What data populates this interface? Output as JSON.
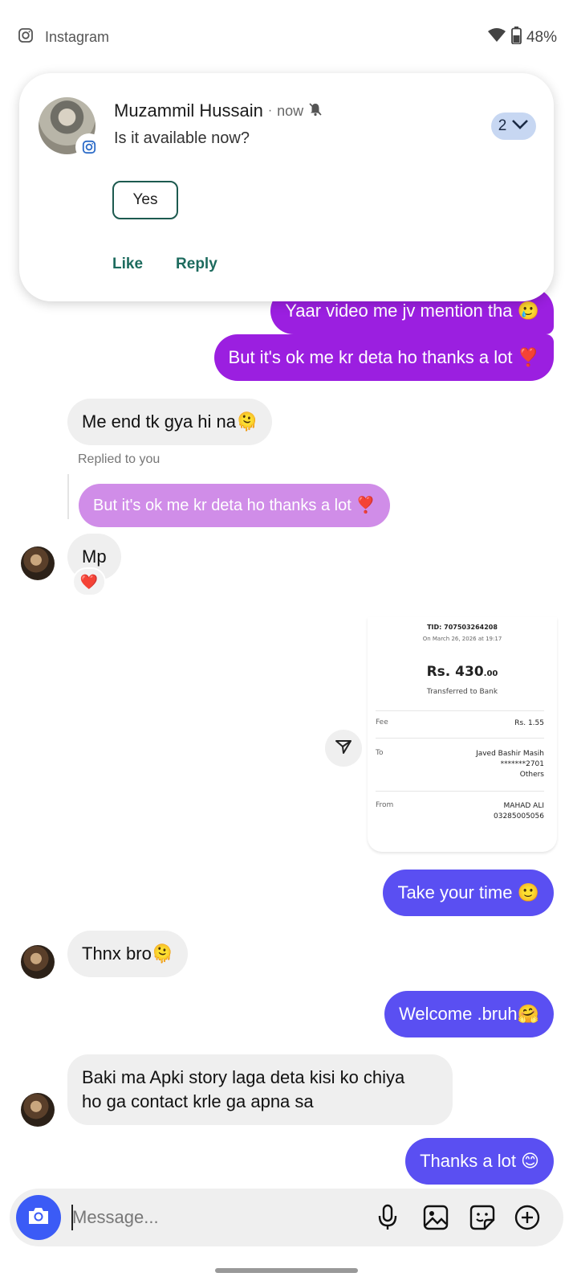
{
  "status_bar": {
    "app_name": "Instagram",
    "battery": "48%"
  },
  "notification": {
    "sender": "Muzammil Hussain",
    "separator": "·",
    "time": "now",
    "message": "Is it available now?",
    "count": "2",
    "quick_reply": "Yes",
    "actions": [
      "Like",
      "Reply"
    ]
  },
  "messages": [
    {
      "side": "sent",
      "text": "Yaar video me jv mention tha 🥲"
    },
    {
      "side": "sent",
      "text": "But it's ok me kr deta ho thanks a lot ❣️"
    },
    {
      "side": "received",
      "text": "Me end tk gya hi na🫠"
    },
    {
      "side": "received",
      "replied_label": "Replied to you",
      "quoted": "But it's ok me kr deta ho thanks a lot ❣️",
      "text": "Mp",
      "reaction": "❤️"
    },
    {
      "side": "sent",
      "type": "image",
      "receipt": {
        "tid": "TID: 707503264208",
        "date": "On March 26, 2026 at 19:17",
        "amount": "Rs. 430",
        "amount_decimals": ".00",
        "status": "Transferred to Bank",
        "fee_label": "Fee",
        "fee_value": "Rs. 1.55",
        "to_label": "To",
        "to_lines": [
          "Javed Bashir Masih",
          "*******2701",
          "Others"
        ],
        "from_label": "From",
        "from_lines": [
          "MAHAD ALI",
          "03285005056"
        ]
      }
    },
    {
      "side": "sent",
      "text": "Take your time 🙂"
    },
    {
      "side": "received",
      "text": "Thnx bro🫠"
    },
    {
      "side": "sent",
      "text": "Welcome .bruh🤗"
    },
    {
      "side": "received",
      "text": "Baki ma Apki story laga deta kisi ko chiya",
      "text_line2": "ho ga contact krle ga apna sa"
    },
    {
      "side": "sent",
      "text": "Thanks a lot 😊"
    }
  ],
  "composer": {
    "placeholder": "Message..."
  },
  "colors": {
    "sent_purple": "#9b1fe0",
    "sent_violet": "#5a4ff2",
    "reply_pink": "#d08de8",
    "received_gray": "#efefef",
    "camera_blue": "#3b5bf6"
  },
  "icons": [
    "instagram-icon",
    "wifi-icon",
    "battery-icon",
    "bell-off-icon",
    "chevron-down-icon",
    "share-icon",
    "camera-icon",
    "microphone-icon",
    "gallery-icon",
    "sticker-icon",
    "plus-icon"
  ]
}
